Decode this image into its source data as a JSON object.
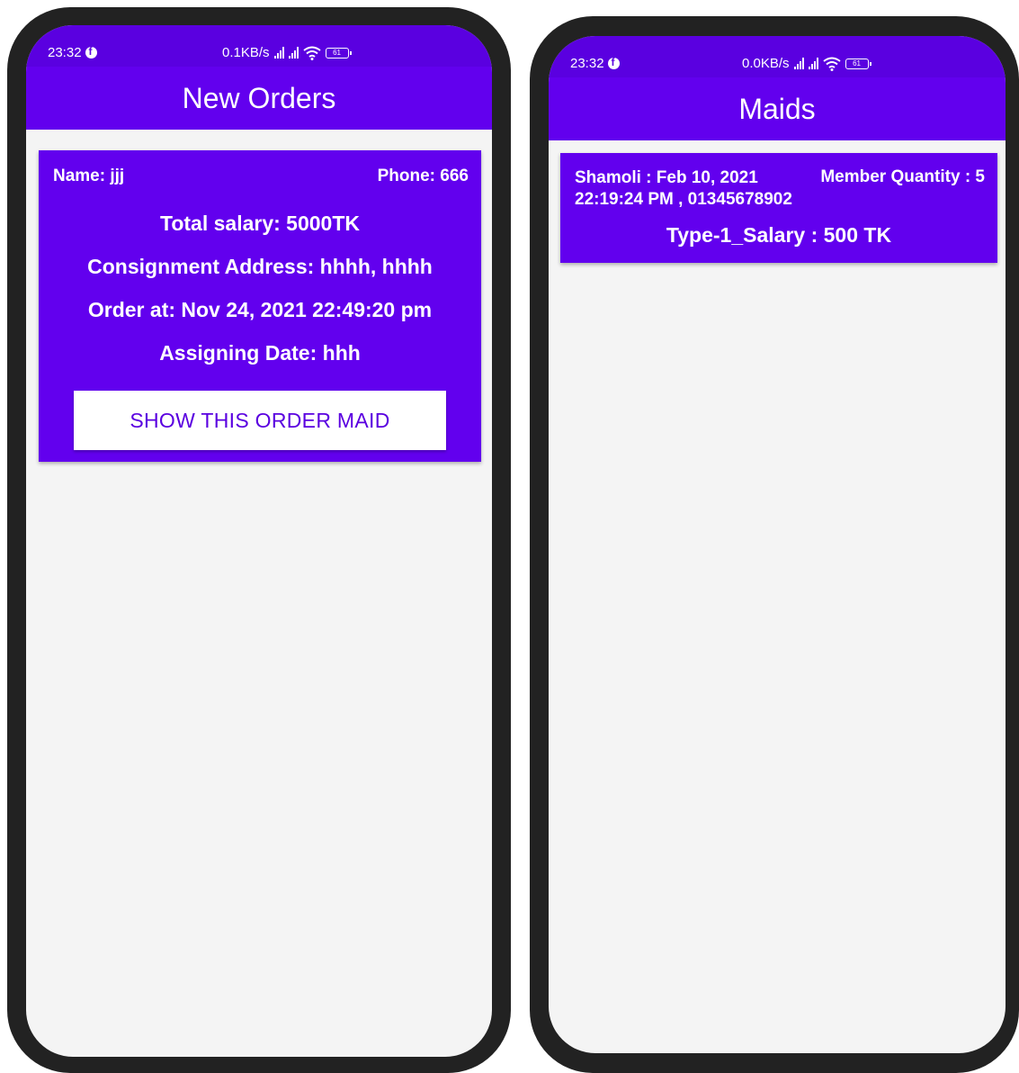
{
  "colors": {
    "primary": "#6200ee",
    "status_bar": "#5a00e0",
    "background": "#f4f4f4",
    "frame": "#222222"
  },
  "left_phone": {
    "status": {
      "time": "23:32",
      "speed": "0.1KB/s",
      "battery": "61"
    },
    "title": "New Orders",
    "order": {
      "name": "Name: jjj",
      "phone": "Phone: 666",
      "total_salary": "Total salary: 5000TK",
      "address": "Consignment Address: hhhh, hhhh",
      "order_at": "Order at: Nov 24, 2021 22:49:20 pm",
      "assigning_date": "Assigning Date: hhh",
      "button_label": "SHOW THIS ORDER MAID"
    }
  },
  "right_phone": {
    "status": {
      "time": "23:32",
      "speed": "0.0KB/s",
      "battery": "61"
    },
    "title": "Maids",
    "maid": {
      "line1": "Shamoli : Feb 10, 2021",
      "line2": "22:19:24 PM , 01345678902",
      "member_quantity": "Member Quantity : 5",
      "salary": "Type-1_Salary : 500 TK"
    }
  }
}
